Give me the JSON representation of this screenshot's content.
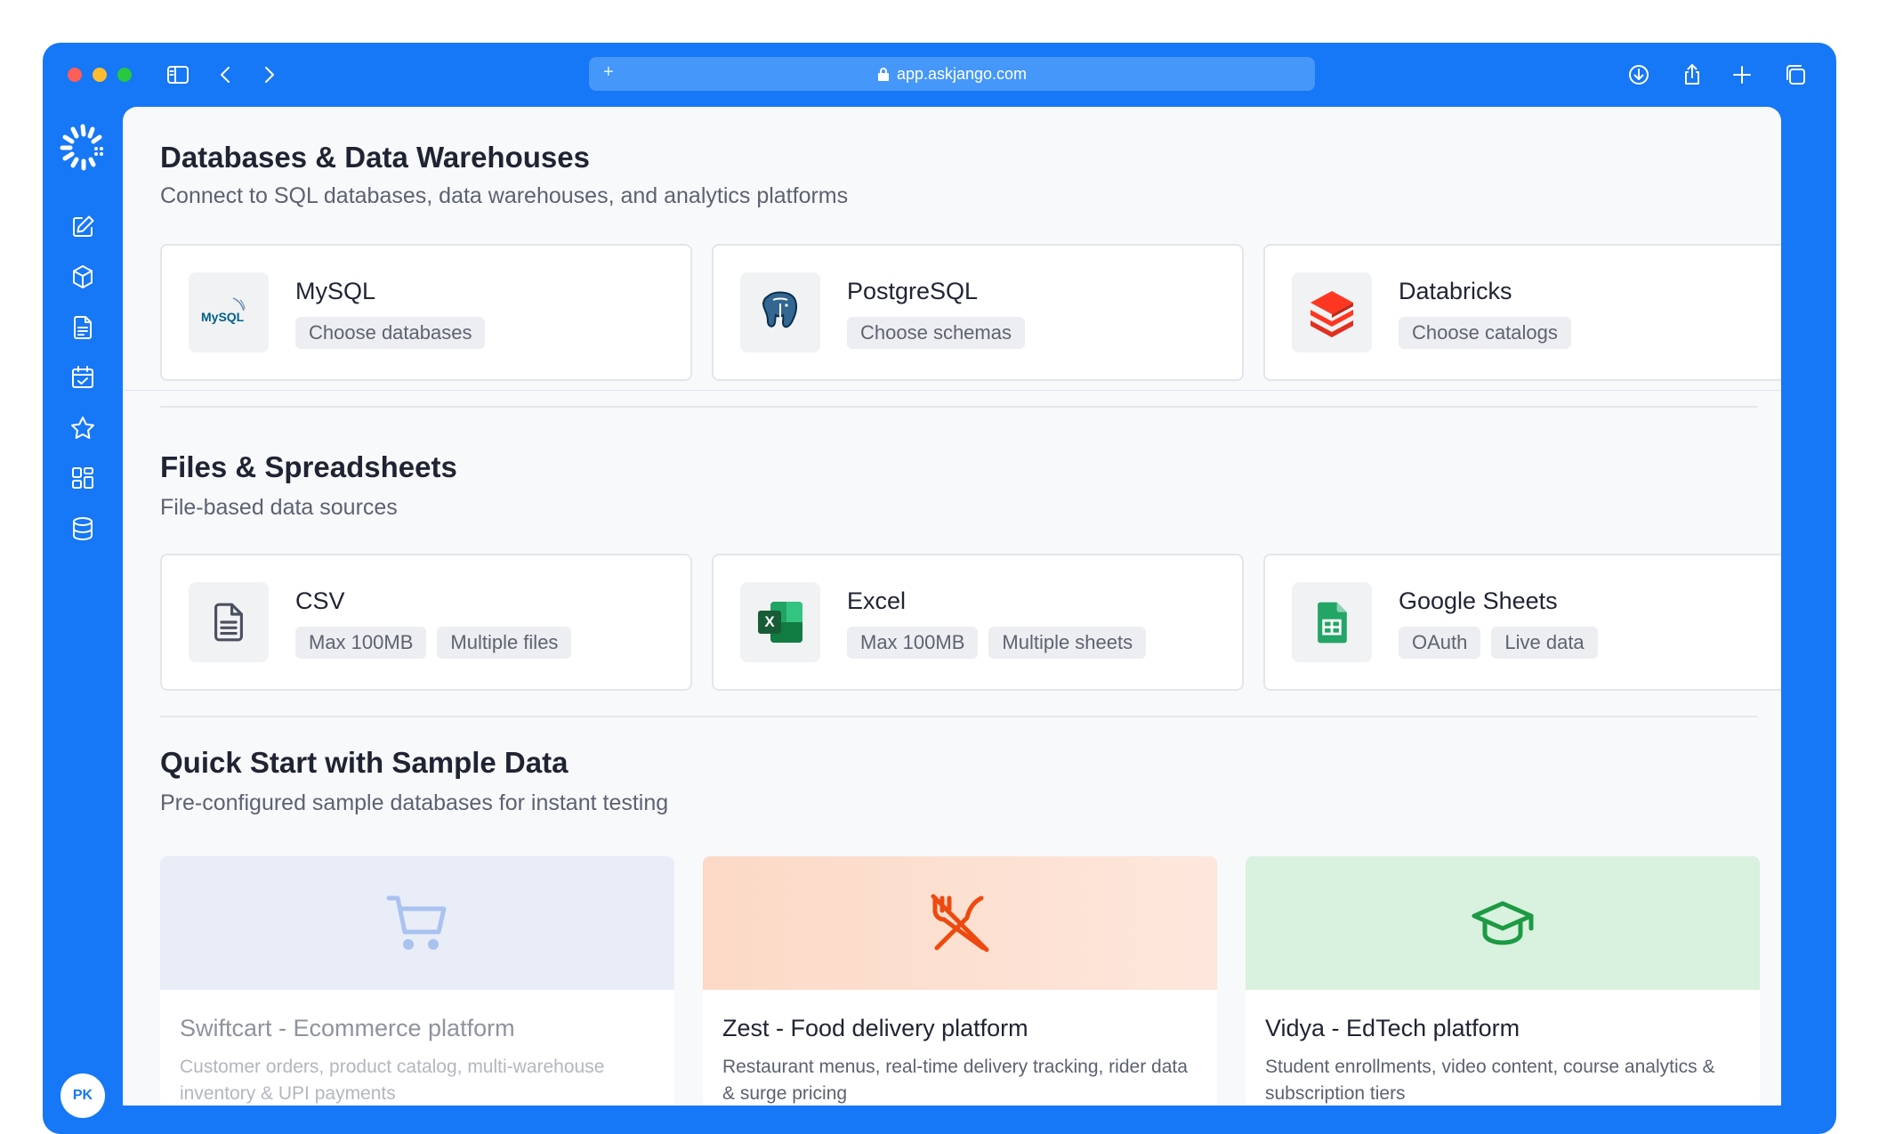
{
  "browser": {
    "url": "app.askjango.com",
    "new_tab_symbol": "+"
  },
  "user": {
    "initials": "PK"
  },
  "accent_color": "#1677f7",
  "sidebar": {
    "items": [
      {
        "icon": "edit-icon"
      },
      {
        "icon": "cube-icon"
      },
      {
        "icon": "document-icon"
      },
      {
        "icon": "calendar-check-icon"
      },
      {
        "icon": "star-icon"
      },
      {
        "icon": "grid-icon"
      },
      {
        "icon": "database-icon"
      }
    ]
  },
  "databases": {
    "title": "Databases & Data Warehouses",
    "subtitle": "Connect to SQL databases, data warehouses, and analytics platforms",
    "cards": [
      {
        "name": "MySQL",
        "logo_text": "MySQL",
        "tags": [
          "Choose databases"
        ]
      },
      {
        "name": "PostgreSQL",
        "tags": [
          "Choose schemas"
        ]
      },
      {
        "name": "Databricks",
        "tags": [
          "Choose catalogs"
        ]
      }
    ]
  },
  "files": {
    "title": "Files & Spreadsheets",
    "subtitle": "File-based data sources",
    "cards": [
      {
        "name": "CSV",
        "tags": [
          "Max 100MB",
          "Multiple files"
        ]
      },
      {
        "name": "Excel",
        "logo_text": "X",
        "tags": [
          "Max 100MB",
          "Multiple sheets"
        ]
      },
      {
        "name": "Google Sheets",
        "tags": [
          "OAuth",
          "Live data"
        ]
      }
    ]
  },
  "samples": {
    "title": "Quick Start with Sample Data",
    "subtitle": "Pre-configured sample databases for instant testing",
    "cards": [
      {
        "title": "Swiftcart - Ecommerce platform",
        "description": "Customer orders, product catalog, multi-warehouse inventory & UPI payments",
        "color": "#e8edf8"
      },
      {
        "title": "Zest - Food delivery platform",
        "description": "Restaurant menus, real-time delivery tracking, rider data & surge pricing",
        "color": "#fde3d6"
      },
      {
        "title": "Vidya - EdTech platform",
        "description": "Student enrollments, video content, course analytics & subscription tiers",
        "color": "#d9f1df"
      }
    ]
  }
}
